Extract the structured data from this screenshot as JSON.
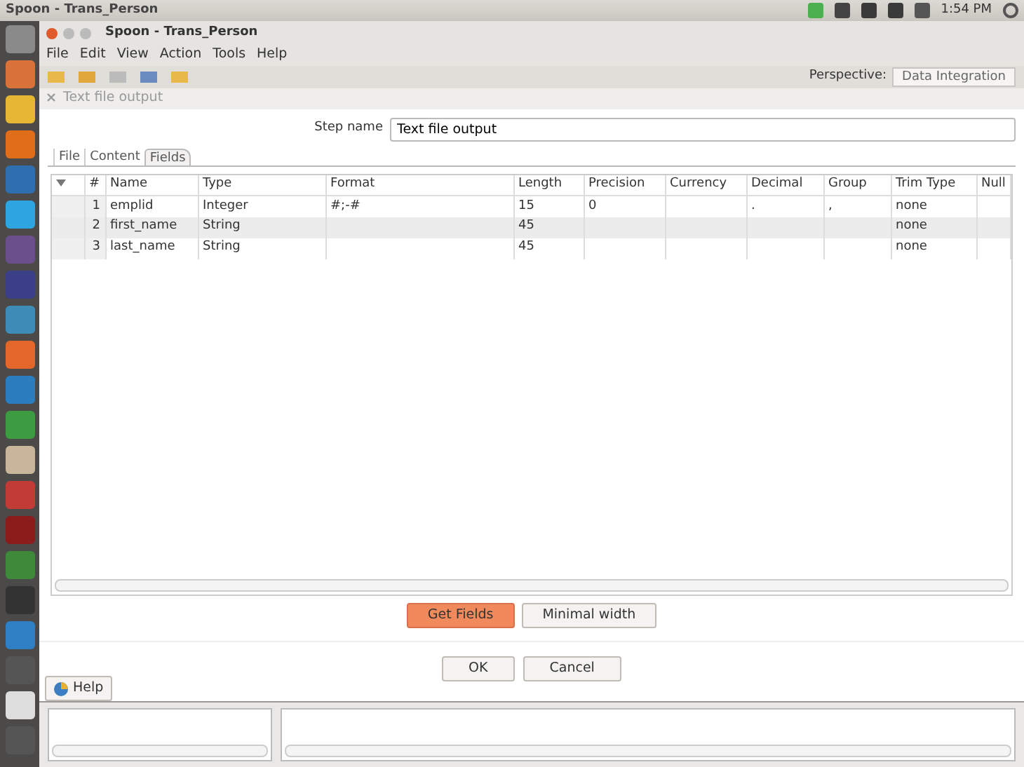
{
  "top_bar": {
    "title": "Spoon - Trans_Person",
    "clock": "1:54 PM"
  },
  "window": {
    "title": "Spoon - Trans_Person",
    "menu": [
      "File",
      "Edit",
      "View",
      "Action",
      "Tools",
      "Help"
    ],
    "perspective_label": "Perspective:",
    "perspective": "Data Integration"
  },
  "dialog": {
    "title": "Text file output",
    "step_name_label": "Step name",
    "step_name": "Text file output",
    "tabs": [
      {
        "label": "File",
        "selected": false
      },
      {
        "label": "Content",
        "selected": false
      },
      {
        "label": "Fields",
        "selected": true
      }
    ],
    "table": {
      "columns": [
        "#",
        "Name",
        "Type",
        "Format",
        "Length",
        "Precision",
        "Currency",
        "Decimal",
        "Group",
        "Trim Type",
        "Null"
      ],
      "rows": [
        {
          "number": "1",
          "name": "emplid",
          "type": "Integer",
          "format": "#;-#",
          "length": "15",
          "precision": "0",
          "decimal": ".",
          "group": ",",
          "trim_type": "none"
        },
        {
          "number": "2",
          "name": "first_name",
          "type": "String",
          "length": "45",
          "trim_type": "none"
        },
        {
          "number": "3",
          "name": "last_name",
          "type": "String",
          "length": "45",
          "trim_type": "none"
        }
      ]
    },
    "field_buttons": [
      {
        "label": "Get Fields",
        "focused": true
      },
      {
        "label": "Minimal width",
        "focused": false
      }
    ],
    "buttons": [
      "OK",
      "Cancel"
    ],
    "help": "Help"
  }
}
